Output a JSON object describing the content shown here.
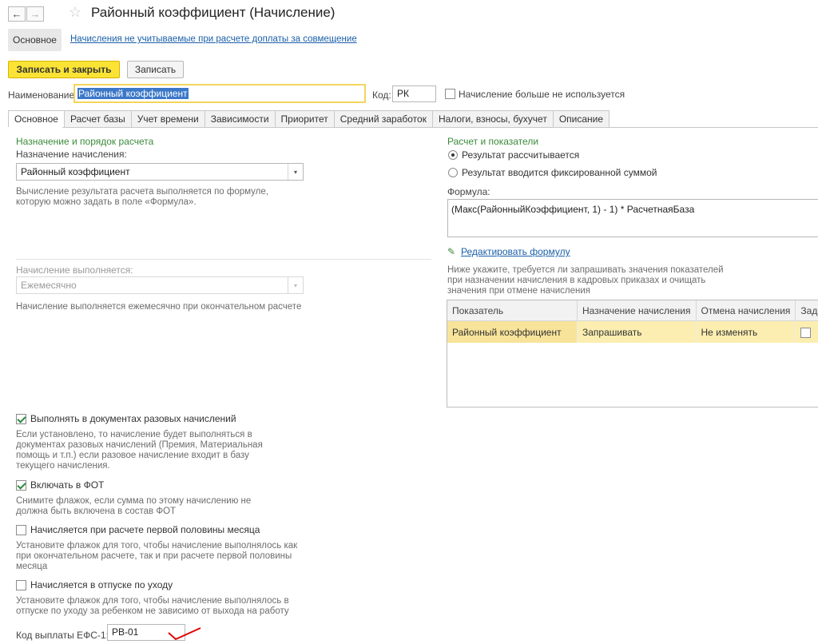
{
  "window": {
    "title": "Районный коэффициент (Начисление)"
  },
  "form_nav": {
    "main_tab": "Основное",
    "link": "Начисления не учитываемые при расчете доплаты за совмещение"
  },
  "toolbar": {
    "save_close": "Записать и закрыть",
    "save": "Записать"
  },
  "header": {
    "name_label": "Наименование:",
    "name_value": "Районный коэффициент",
    "code_label": "Код:",
    "code_value": "РК",
    "not_used_label": "Начисление больше не используется"
  },
  "tabs": [
    "Основное",
    "Расчет базы",
    "Учет времени",
    "Зависимости",
    "Приоритет",
    "Средний заработок",
    "Налоги, взносы, бухучет",
    "Описание"
  ],
  "left": {
    "section_title": "Назначение и порядок расчета",
    "purpose_label": "Назначение начисления:",
    "purpose_value": "Районный коэффициент",
    "purpose_hint_1": "Вычисление результата расчета выполняется по формуле,",
    "purpose_hint_2": "которую можно задать в поле «Формула».",
    "schedule_label": "Начисление выполняется:",
    "schedule_value": "Ежемесячно",
    "schedule_hint": "Начисление выполняется ежемесячно при окончательном расчете",
    "one_time_label": "Выполнять в документах разовых начислений",
    "one_time_checked": true,
    "one_time_hint": [
      "Если установлено, то начисление будет выполняться в",
      "документах разовых начислений (Премия, Материальная",
      "помощь и т.п.) если разовое начисление входит в базу",
      "текущего начисления."
    ],
    "fot_label": "Включать в ФОТ",
    "fot_checked": true,
    "fot_hint": [
      "Снимите флажок, если сумма по этому начислению не",
      "должна быть включена в состав ФОТ"
    ],
    "half_month_label": "Начисляется при расчете первой половины месяца",
    "half_month_checked": false,
    "half_month_hint": [
      "Установите флажок для того, чтобы начисление выполнялось как",
      "при окончательном расчете, так и при расчете первой половины",
      "месяца"
    ],
    "leave_label": "Начисляется в отпуске по уходу",
    "leave_checked": false,
    "leave_hint": [
      "Установите флажок для того, чтобы начисление выполнялось в",
      "отпуске по уходу за ребенком не зависимо от выхода на работу"
    ],
    "efs_label": "Код выплаты ЕФС-1:",
    "efs_value": "РВ-01"
  },
  "right": {
    "section_title": "Расчет и показатели",
    "radio_calc": "Результат рассчитывается",
    "radio_fixed": "Результат вводится фиксированной суммой",
    "formula_label": "Формула:",
    "formula_value": "(Макс(РайонныйКоэффициент, 1) - 1) * РасчетнаяБаза",
    "edit_formula": "Редактировать формулу",
    "indicators_hint": [
      "Ниже укажите, требуется ли запрашивать значения показателей",
      "при назначении начисления в кадровых приказах и очищать",
      "значения при отмене начисления"
    ],
    "table_headers": [
      "Показатель",
      "Назначение начисления",
      "Отмена начисления",
      "Задае"
    ],
    "table_rows": [
      {
        "indicator": "Районный коэффициент",
        "assign": "Запрашивать",
        "cancel": "Не изменять",
        "flag": false
      }
    ]
  },
  "colors": {
    "accent_yellow": "#fbe335",
    "section_green": "#3b8a3b",
    "link_blue": "#1a5fa8",
    "selection": "#fbeeb0",
    "annotation_red": "#e00000"
  }
}
